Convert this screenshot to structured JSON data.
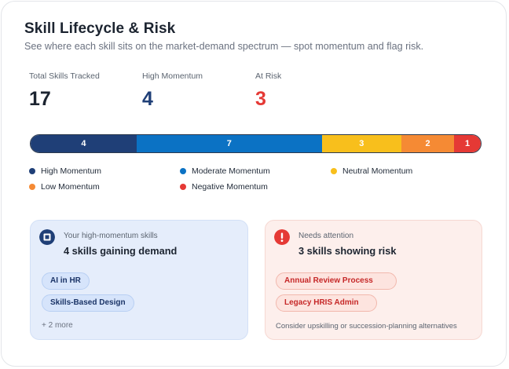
{
  "header": {
    "title": "Skill Lifecycle & Risk",
    "subtitle": "See where each skill sits on the market-demand spectrum — spot momentum and flag risk."
  },
  "stats": [
    {
      "label": "Total Skills Tracked",
      "value": "17",
      "color": "#1c2430"
    },
    {
      "label": "High Momentum",
      "value": "4",
      "color": "#1f3f77"
    },
    {
      "label": "At Risk",
      "value": "3",
      "color": "#e53935"
    }
  ],
  "distribution": {
    "segments": [
      {
        "name": "High Momentum",
        "count": 4,
        "color": "#1f3f77"
      },
      {
        "name": "Moderate Momentum",
        "count": 7,
        "color": "#0b72c4"
      },
      {
        "name": "Neutral Momentum",
        "count": 3,
        "color": "#f8bf1c"
      },
      {
        "name": "Low Momentum",
        "count": 2,
        "color": "#f58a34"
      },
      {
        "name": "Negative Momentum",
        "count": 1,
        "color": "#e53935"
      }
    ]
  },
  "high_panel": {
    "icon": "square-icon",
    "kicker": "Your high-momentum skills",
    "heading": "4 skills gaining demand",
    "chips": [
      "AI in HR",
      "Skills-Based Design"
    ],
    "more": "+ 2 more"
  },
  "risk_panel": {
    "icon": "alert-icon",
    "kicker": "Needs attention",
    "heading": "3 skills showing risk",
    "chips": [
      "Annual Review Process",
      "Legacy HRIS Admin"
    ],
    "note": "Consider upskilling or succession-planning alternatives"
  }
}
